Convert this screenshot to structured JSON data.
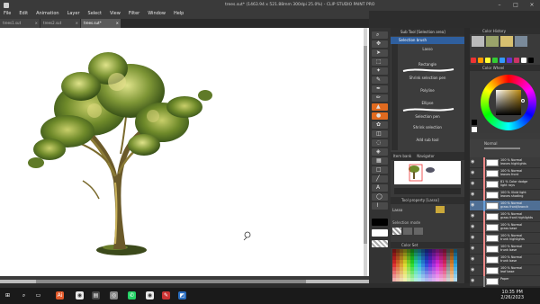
{
  "window": {
    "title": "trees.sut* (1463.94 x 521.88mm 300dpi 25.0%) - CLIP STUDIO PAINT PRO"
  },
  "menu": [
    "File",
    "Edit",
    "Animation",
    "Layer",
    "Select",
    "View",
    "Filter",
    "Window",
    "Help"
  ],
  "doc_tabs": [
    {
      "label": "trees1.sut",
      "active": false
    },
    {
      "label": "trees2.sut",
      "active": false
    },
    {
      "label": "trees.sut*",
      "active": true
    }
  ],
  "subtool": {
    "header": "Sub Tool [Selection area]",
    "selected": "Selection brush",
    "items": [
      "Lasso",
      "Rectangle",
      "Shrink selection pen",
      "Polyline",
      "Ellipse",
      "Selection pen",
      "Shrink selection"
    ],
    "add": "Add sub tool"
  },
  "navigator": {
    "tabs": [
      "Item bank",
      "Navigator"
    ]
  },
  "tool_property": {
    "header": "Tool property [Lasso]",
    "label": "Lasso",
    "mode": "Selection mode"
  },
  "color_set": {
    "header": "Color Set"
  },
  "colors": {
    "accent": "#2f5f9e",
    "canvas": "#ffffff",
    "selected_layer": "#4f6f95"
  },
  "right_panels": {
    "history": "Color History",
    "wheel": "Color Wheel",
    "layer": "Layer",
    "blend": "Normal"
  },
  "layers": [
    {
      "l1": "100 % Normal",
      "l2": "leaves highlights",
      "bar": "#e88",
      "selected": false
    },
    {
      "l1": "100 % Normal",
      "l2": "leaves front",
      "bar": "#e88",
      "selected": false
    },
    {
      "l1": "81 % Color dodge",
      "l2": "light rays",
      "bar": "#e88",
      "selected": false
    },
    {
      "l1": "100 % Vivid light",
      "l2": "leaves shading",
      "bar": "#e88",
      "selected": false
    },
    {
      "l1": "100 % Normal",
      "l2": "grass front/branch",
      "bar": "#6aa0d8",
      "selected": true
    },
    {
      "l1": "100 % Normal",
      "l2": "grass front highlights",
      "bar": "#e88",
      "selected": false
    },
    {
      "l1": "100 % Normal",
      "l2": "grass base",
      "bar": "#e88",
      "selected": false
    },
    {
      "l1": "100 % Normal",
      "l2": "trunk highlights",
      "bar": "#e88",
      "selected": false
    },
    {
      "l1": "100 % Normal",
      "l2": "trunk base",
      "bar": "#e88",
      "selected": false
    },
    {
      "l1": "100 % Normal",
      "l2": "trunk base",
      "bar": "#e88",
      "selected": false
    },
    {
      "l1": "100 % Normal",
      "l2": "leaf base",
      "bar": "#e88",
      "selected": false
    },
    {
      "l1": "Paper",
      "l2": "",
      "bar": "#888",
      "selected": false
    }
  ],
  "taskbar": {
    "time": "10:35 PM",
    "date": "2/26/2023"
  }
}
